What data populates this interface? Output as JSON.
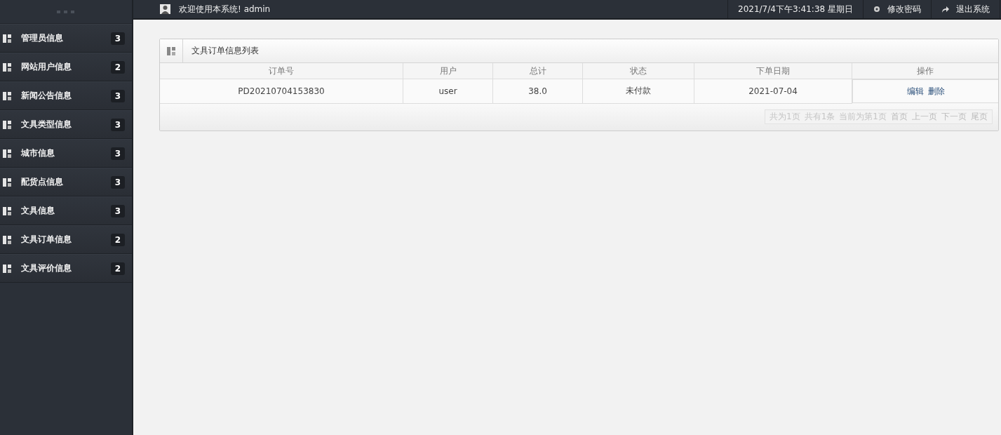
{
  "top_bar": {
    "welcome": "欢迎使用本系统! admin",
    "datetime": "2021/7/4下午3:41:38 星期日",
    "change_password": "修改密码",
    "logout": "退出系统"
  },
  "sidebar": {
    "items": [
      {
        "label": "管理员信息",
        "count": "3"
      },
      {
        "label": "网站用户信息",
        "count": "2"
      },
      {
        "label": "新闻公告信息",
        "count": "3"
      },
      {
        "label": "文具类型信息",
        "count": "3"
      },
      {
        "label": "城市信息",
        "count": "3"
      },
      {
        "label": "配货点信息",
        "count": "3"
      },
      {
        "label": "文具信息",
        "count": "3"
      },
      {
        "label": "文具订单信息",
        "count": "2"
      },
      {
        "label": "文具评价信息",
        "count": "2"
      }
    ]
  },
  "panel": {
    "title": "文具订单信息列表",
    "table": {
      "columns": [
        "订单号",
        "用户",
        "总计",
        "状态",
        "下单日期",
        "操作"
      ],
      "rows": [
        {
          "cells": [
            "PD20210704153830",
            "user",
            "38.0",
            "未付款",
            "2021-07-04"
          ],
          "actions": [
            "编辑",
            "删除"
          ]
        }
      ]
    },
    "pagination": [
      {
        "text": "共为1页",
        "kind": "info"
      },
      {
        "text": "共有1条",
        "kind": "info"
      },
      {
        "text": "当前为第1页",
        "kind": "info"
      },
      {
        "text": "首页",
        "kind": "link"
      },
      {
        "text": "上一页",
        "kind": "link"
      },
      {
        "text": "下一页",
        "kind": "link"
      },
      {
        "text": "尾页",
        "kind": "link"
      }
    ]
  }
}
